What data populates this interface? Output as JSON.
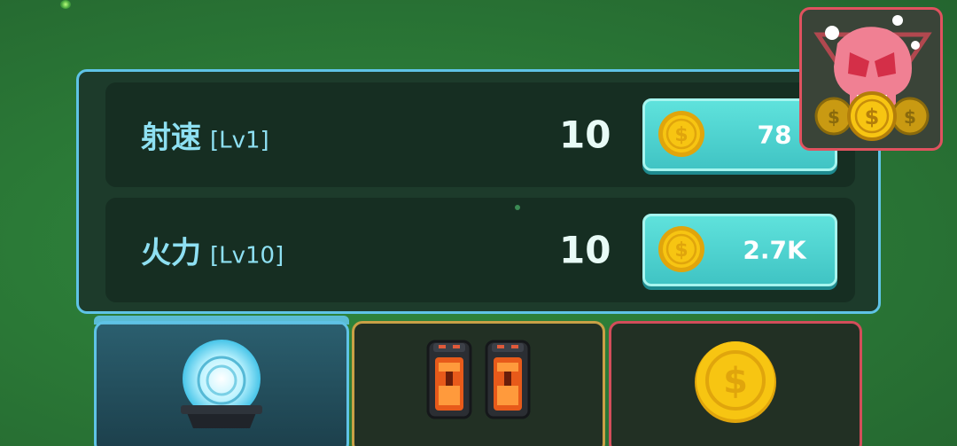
{
  "colors": {
    "accent_cyan": "#5fc3e6",
    "row_text": "#8ee0f2",
    "button_fill": "#4fd3d0",
    "coin_gold": "#f7c512",
    "boss_red": "#e0525f"
  },
  "upgrades": [
    {
      "name": "射速",
      "level": "[Lv1]",
      "value": "10",
      "cost": "78",
      "cost_icon": "coin-icon"
    },
    {
      "name": "火力",
      "level": "[Lv10]",
      "value": "10",
      "cost": "2.7K",
      "cost_icon": "coin-icon"
    }
  ],
  "boss_badge": {
    "icons": [
      "skull-icon",
      "coin-stack-icon"
    ]
  },
  "tabs": [
    {
      "id": "weapon",
      "icon": "plasma-orb-icon",
      "selected": true
    },
    {
      "id": "fuel",
      "icon": "fuel-canister-icon",
      "selected": false
    },
    {
      "id": "coin",
      "icon": "coin-icon",
      "selected": false
    }
  ]
}
